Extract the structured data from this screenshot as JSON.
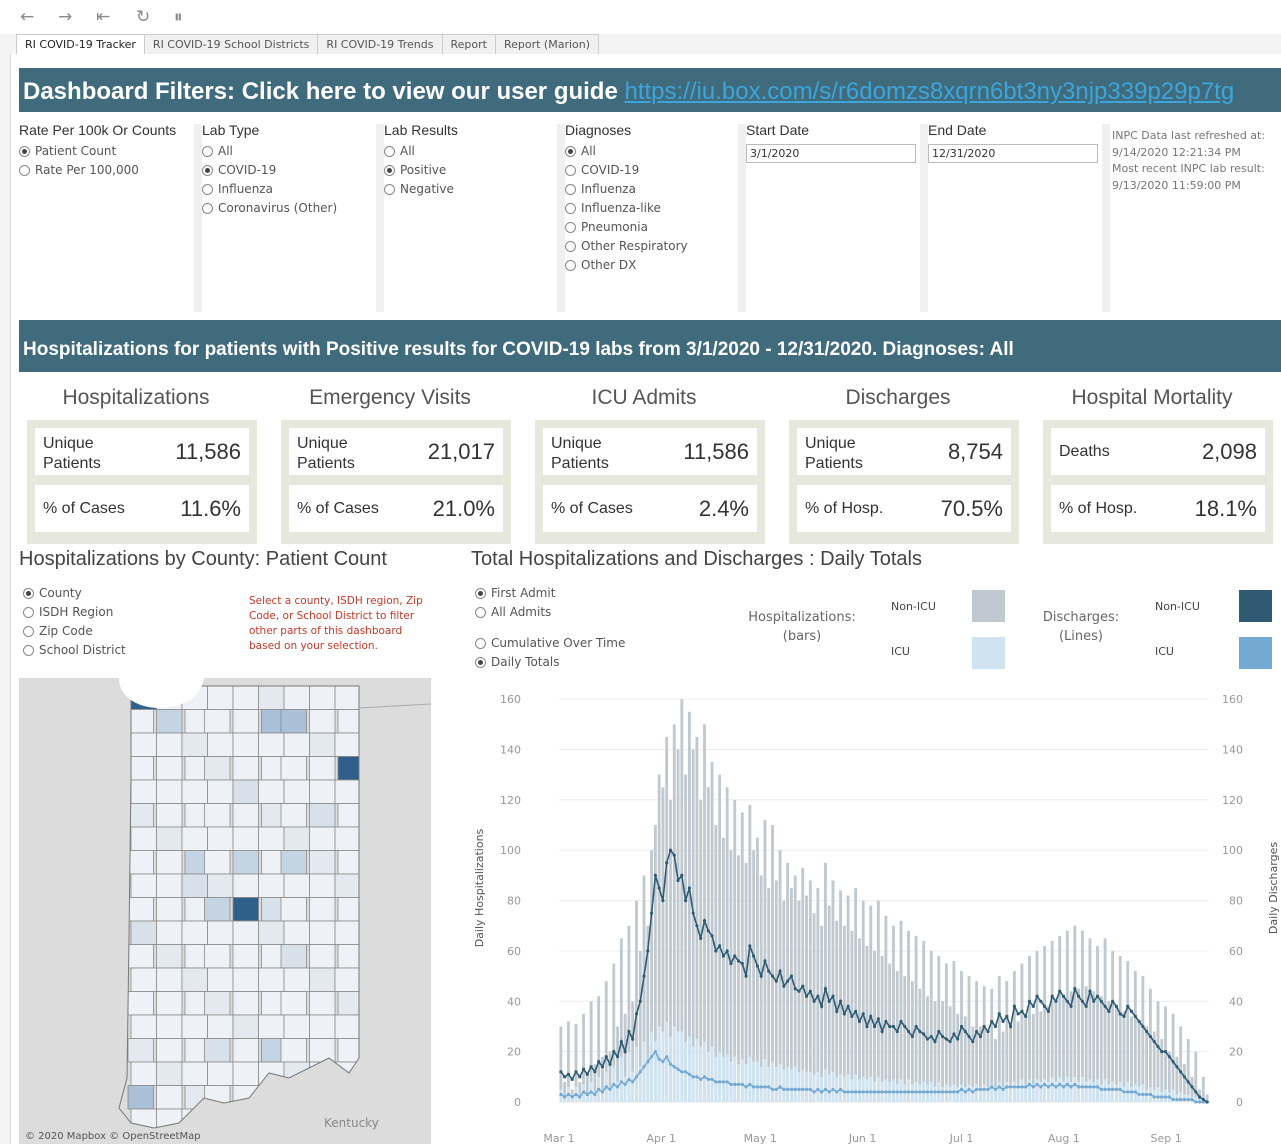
{
  "toolbar": {
    "icons": [
      "back-arrow",
      "forward-arrow",
      "revert-all",
      "refresh",
      "pause-updates"
    ],
    "glyphs": [
      "←",
      "→",
      "⇤",
      "↻",
      "⏸"
    ]
  },
  "tabs": [
    "RI COVID-19 Tracker",
    "RI COVID-19 School Districts",
    "RI COVID-19 Trends",
    "Report",
    "Report (Marion)"
  ],
  "filters_banner": {
    "text": "Dashboard Filters: Click here to view our user guide",
    "link": "https://iu.box.com/s/r6domzs8xqrn6bt3ny3njp339p29p7tg"
  },
  "filters": {
    "rate": {
      "title": "Rate Per 100k Or Counts",
      "options": [
        "Patient Count",
        "Rate Per 100,000"
      ],
      "selected": 0
    },
    "lab_type": {
      "title": "Lab Type",
      "options": [
        "All",
        "COVID-19",
        "Influenza",
        "Coronavirus (Other)"
      ],
      "selected": 1
    },
    "lab_results": {
      "title": "Lab Results",
      "options": [
        "All",
        "Positive",
        "Negative"
      ],
      "selected": 1
    },
    "diagnoses": {
      "title": "Diagnoses",
      "options": [
        "All",
        "COVID-19",
        "Influenza",
        "Influenza-like",
        "Pneumonia",
        "Other Respiratory",
        "Other DX"
      ],
      "selected": 0
    },
    "start_date": {
      "title": "Start Date",
      "value": "3/1/2020"
    },
    "end_date": {
      "title": "End Date",
      "value": "12/31/2020"
    },
    "refresh": {
      "line1": "INPC Data last refreshed at:",
      "time1": "9/14/2020 12:21:34 PM",
      "line2": "Most recent INPC lab result:",
      "time2": "9/13/2020 11:59:00 PM"
    }
  },
  "summary_banner": "Hospitalizations for patients with Positive results for COVID-19 labs from 3/1/2020 - 12/31/2020. Diagnoses: All",
  "kpis": [
    {
      "title": "Hospitalizations",
      "l1": "Unique Patients",
      "v1": "11,586",
      "l2": "% of Cases",
      "v2": "11.6%"
    },
    {
      "title": "Emergency Visits",
      "l1": "Unique Patients",
      "v1": "21,017",
      "l2": "% of Cases",
      "v2": "21.0%"
    },
    {
      "title": "ICU Admits",
      "l1": "Unique Patients",
      "v1": "11,586",
      "l2": "% of Cases",
      "v2": "2.4%"
    },
    {
      "title": "Discharges",
      "l1": "Unique Patients",
      "v1": "8,754",
      "l2": "% of Hosp.",
      "v2": "70.5%"
    },
    {
      "title": "Hospital Mortality",
      "l1": "Deaths",
      "v1": "2,098",
      "l2": "% of Hosp.",
      "v2": "18.1%"
    }
  ],
  "map": {
    "title": "Hospitalizations by County: Patient Count",
    "options": [
      "County",
      "ISDH Region",
      "Zip Code",
      "School District"
    ],
    "selected": 0,
    "note": "Select a county, ISDH region, Zip Code, or School District to filter other parts of this dashboard based on your selection.",
    "credit": "© 2020 Mapbox © OpenStreetMap",
    "neighbor": "Kentucky"
  },
  "chart": {
    "title": "Total Hospitalizations and Discharges : Daily Totals",
    "admit_options": [
      "First Admit",
      "All Admits"
    ],
    "admit_selected": 0,
    "mode_options": [
      "Cumulative Over Time",
      "Daily Totals"
    ],
    "mode_selected": 1,
    "legend": {
      "hosp": "Hospitalizations: (bars)",
      "disc": "Discharges: (Lines)",
      "non_icu": "Non-ICU",
      "icu": "ICU"
    },
    "colors": {
      "bar_nonicu": "#bfc9cf",
      "bar_icu": "#cfe3f0",
      "line_nonicu": "#2f5a72",
      "line_icu": "#74a9d4"
    }
  },
  "chart_data": {
    "type": "bar",
    "xlabel": "",
    "ylabel": "Daily Hospitalizations",
    "y2label": "Daily Discharges",
    "ylim": [
      0,
      170
    ],
    "yticks": [
      0,
      20,
      40,
      60,
      80,
      100,
      120,
      140,
      160
    ],
    "xticks": [
      "Mar 1",
      "Apr 1",
      "May 1",
      "Jun 1",
      "Jul 1",
      "Aug 1",
      "Sep 1"
    ],
    "x_start": "2020-03-01",
    "x_end": "2020-09-14",
    "grid": true,
    "series": [
      {
        "name": "Non-ICU",
        "kind": "bars",
        "values": [
          30,
          8,
          32,
          5,
          31,
          8,
          35,
          12,
          40,
          15,
          42,
          18,
          48,
          20,
          55,
          30,
          65,
          35,
          70,
          40,
          80,
          60,
          90,
          70,
          100,
          110,
          130,
          125,
          145,
          120,
          150,
          140,
          160,
          130,
          155,
          140,
          145,
          120,
          150,
          125,
          135,
          110,
          130,
          105,
          125,
          100,
          120,
          98,
          115,
          95,
          118,
          100,
          105,
          90,
          112,
          85,
          110,
          88,
          100,
          80,
          95,
          85,
          90,
          80,
          93,
          82,
          88,
          75,
          85,
          70,
          95,
          78,
          88,
          72,
          84,
          70,
          82,
          68,
          85,
          65,
          80,
          62,
          78,
          60,
          80,
          58,
          74,
          55,
          70,
          52,
          72,
          50,
          68,
          48,
          66,
          45,
          64,
          42,
          60,
          40,
          58,
          40,
          55,
          38,
          56,
          35,
          52,
          34,
          50,
          30,
          48,
          30,
          46,
          28,
          45,
          25,
          50,
          28,
          48,
          30,
          52,
          32,
          55,
          34,
          58,
          35,
          60,
          36,
          62,
          38,
          64,
          40,
          66,
          42,
          68,
          44,
          70,
          45,
          68,
          46,
          65,
          44,
          62,
          42,
          65,
          40,
          60,
          38,
          58,
          36,
          56,
          34,
          52,
          32,
          50,
          30,
          45,
          28,
          40,
          25,
          38,
          20,
          35,
          18,
          30,
          15,
          25,
          10,
          20,
          5,
          10,
          3
        ]
      },
      {
        "name": "ICU",
        "kind": "bars",
        "values": [
          5,
          2,
          6,
          2,
          6,
          3,
          7,
          3,
          8,
          4,
          10,
          5,
          12,
          6,
          14,
          8,
          18,
          10,
          20,
          12,
          22,
          14,
          24,
          16,
          28,
          24,
          30,
          28,
          32,
          26,
          30,
          28,
          28,
          24,
          26,
          22,
          25,
          22,
          24,
          20,
          22,
          18,
          20,
          18,
          19,
          16,
          18,
          15,
          17,
          15,
          18,
          16,
          16,
          14,
          17,
          14,
          16,
          14,
          15,
          13,
          14,
          13,
          14,
          12,
          13,
          12,
          12,
          11,
          12,
          10,
          13,
          11,
          12,
          10,
          11,
          10,
          11,
          9,
          11,
          9,
          10,
          9,
          10,
          8,
          10,
          8,
          9,
          8,
          9,
          7,
          9,
          7,
          9,
          7,
          8,
          7,
          8,
          7,
          8,
          6,
          8,
          6,
          7,
          6,
          7,
          6,
          7,
          6,
          7,
          6,
          7,
          6,
          7,
          6,
          7,
          6,
          8,
          6,
          8,
          7,
          8,
          7,
          9,
          7,
          9,
          7,
          9,
          8,
          9,
          8,
          10,
          8,
          10,
          8,
          10,
          8,
          10,
          8,
          10,
          8,
          9,
          8,
          9,
          7,
          9,
          7,
          8,
          7,
          8,
          6,
          8,
          6,
          7,
          6,
          7,
          5,
          6,
          5,
          6,
          4,
          5,
          4,
          5,
          3,
          4,
          3,
          3,
          2,
          2,
          1,
          1,
          0
        ]
      },
      {
        "name": "Non-ICU",
        "kind": "line",
        "values": [
          12,
          10,
          11,
          9,
          12,
          10,
          13,
          11,
          14,
          12,
          16,
          14,
          18,
          15,
          20,
          18,
          24,
          20,
          28,
          25,
          35,
          40,
          50,
          60,
          75,
          90,
          85,
          80,
          95,
          100,
          98,
          88,
          90,
          80,
          85,
          75,
          70,
          65,
          72,
          68,
          66,
          60,
          62,
          58,
          60,
          55,
          58,
          56,
          55,
          50,
          62,
          58,
          54,
          50,
          56,
          52,
          50,
          48,
          52,
          46,
          48,
          50,
          45,
          44,
          46,
          42,
          44,
          40,
          42,
          38,
          45,
          40,
          42,
          36,
          40,
          35,
          38,
          34,
          36,
          32,
          35,
          30,
          34,
          30,
          33,
          28,
          32,
          30,
          30,
          28,
          32,
          30,
          28,
          26,
          30,
          28,
          27,
          25,
          26,
          24,
          28,
          26,
          25,
          24,
          27,
          25,
          30,
          28,
          26,
          24,
          28,
          26,
          30,
          28,
          32,
          30,
          35,
          32,
          34,
          30,
          38,
          35,
          36,
          34,
          40,
          38,
          42,
          40,
          38,
          36,
          42,
          40,
          44,
          42,
          40,
          38,
          45,
          42,
          40,
          38,
          44,
          40,
          42,
          40,
          38,
          36,
          40,
          38,
          35,
          34,
          38,
          36,
          34,
          32,
          30,
          28,
          26,
          24,
          22,
          20,
          20,
          18,
          16,
          14,
          12,
          10,
          8,
          6,
          4,
          2,
          1,
          0
        ]
      },
      {
        "name": "ICU",
        "kind": "line",
        "values": [
          3,
          2,
          3,
          2,
          3,
          2,
          4,
          3,
          4,
          3,
          5,
          4,
          6,
          5,
          7,
          6,
          8,
          7,
          9,
          8,
          10,
          12,
          14,
          16,
          18,
          20,
          17,
          16,
          18,
          15,
          14,
          13,
          12,
          12,
          11,
          10,
          10,
          9,
          10,
          9,
          9,
          8,
          8,
          8,
          8,
          7,
          7,
          7,
          7,
          6,
          7,
          6,
          6,
          6,
          6,
          6,
          5,
          5,
          6,
          5,
          5,
          5,
          5,
          5,
          5,
          5,
          5,
          4,
          5,
          4,
          5,
          4,
          5,
          4,
          5,
          4,
          4,
          4,
          4,
          4,
          4,
          4,
          4,
          4,
          4,
          4,
          4,
          4,
          4,
          4,
          4,
          4,
          4,
          4,
          4,
          4,
          4,
          4,
          4,
          4,
          4,
          4,
          4,
          4,
          4,
          4,
          5,
          4,
          5,
          4,
          5,
          5,
          5,
          5,
          6,
          5,
          6,
          5,
          6,
          6,
          6,
          6,
          6,
          6,
          7,
          6,
          7,
          6,
          7,
          6,
          7,
          6,
          7,
          6,
          7,
          6,
          7,
          6,
          6,
          6,
          6,
          6,
          6,
          5,
          5,
          5,
          5,
          5,
          5,
          4,
          4,
          4,
          4,
          3,
          3,
          3,
          3,
          2,
          2,
          2,
          2,
          2,
          1,
          1,
          1,
          1,
          1,
          1,
          0,
          0,
          0,
          0
        ]
      }
    ]
  }
}
